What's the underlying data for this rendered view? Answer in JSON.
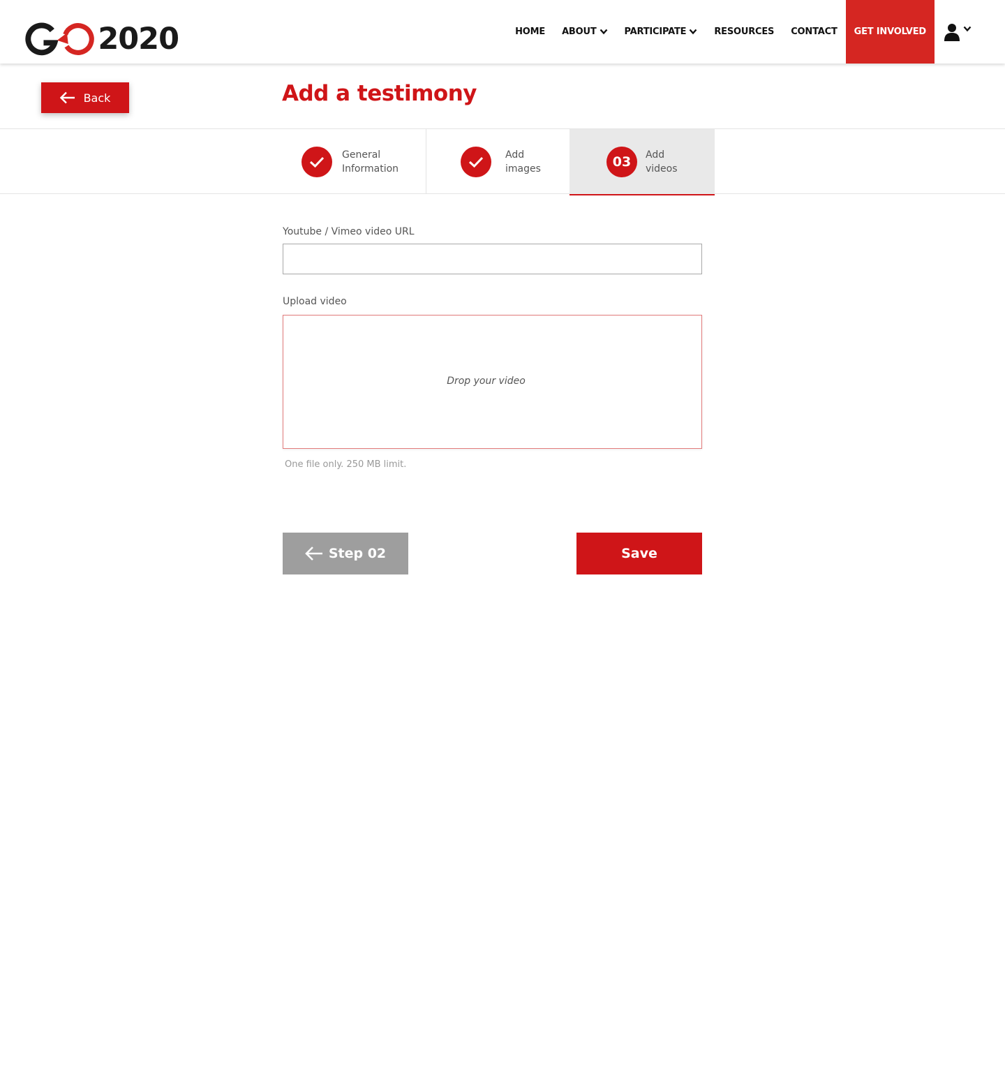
{
  "header": {
    "logo": {
      "text": "2020",
      "letter": "G"
    },
    "nav": [
      {
        "label": "HOME",
        "has_dropdown": false
      },
      {
        "label": "ABOUT",
        "has_dropdown": true
      },
      {
        "label": "PARTICIPATE",
        "has_dropdown": true
      },
      {
        "label": "RESOURCES",
        "has_dropdown": false
      },
      {
        "label": "CONTACT",
        "has_dropdown": false
      },
      {
        "label": "GET INVOLVED",
        "has_dropdown": false
      }
    ],
    "user_icon": "user-icon"
  },
  "page": {
    "back_label": "Back",
    "title": "Add a testimony"
  },
  "steps": [
    {
      "status": "done",
      "line1": "General",
      "line2": "Information"
    },
    {
      "status": "done",
      "line1": "Add",
      "line2": "images"
    },
    {
      "status": "current",
      "number": "03",
      "line1": "Add",
      "line2": "videos"
    }
  ],
  "form": {
    "url_label": "Youtube / Vimeo video URL",
    "url_value": "",
    "upload_label": "Upload video",
    "dropzone_text": "Drop your video",
    "hint": "One file only. 250 MB limit."
  },
  "actions": {
    "prev_label": "Step 02",
    "save_label": "Save"
  },
  "colors": {
    "accent": "#cf1518",
    "cta": "#d52622",
    "secondary_button": "#9e9e9e",
    "active_step_bg": "#e9e9e9"
  }
}
